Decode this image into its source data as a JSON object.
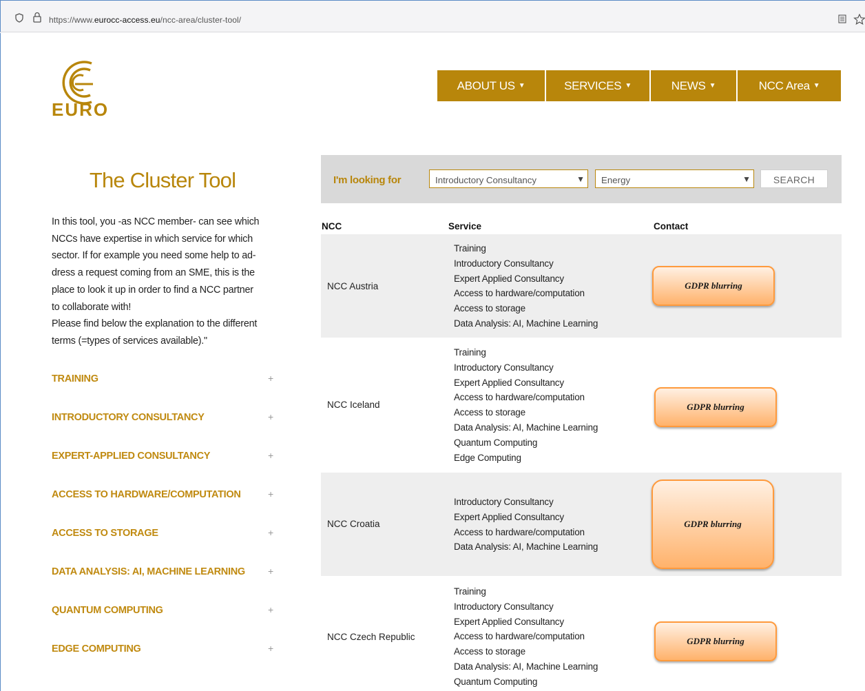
{
  "browser": {
    "url_prefix": "https://www.",
    "url_domain": "eurocc-access.eu",
    "url_path": "/ncc-area/cluster-tool/"
  },
  "logo": {
    "text": "EURO"
  },
  "nav": [
    {
      "label": "ABOUT US"
    },
    {
      "label": "SERVICES"
    },
    {
      "label": "NEWS"
    },
    {
      "label": "NCC Area"
    }
  ],
  "page_title": "The Cluster Tool",
  "intro": [
    "In this tool, you -as NCC member- can see which",
    "NCCs have expertise in which service for which",
    "sector. If for example you need some help to ad-",
    "dress a request coming from an SME, this is the",
    "place to look it up in order to find a NCC partner",
    "to collaborate with!",
    "Please find below the explanation to the different",
    "terms  (=types of services available).\""
  ],
  "accordion": [
    {
      "label": "TRAINING"
    },
    {
      "label": "INTRODUCTORY CONSULTANCY"
    },
    {
      "label": "EXPERT-APPLIED CONSULTANCY"
    },
    {
      "label": "ACCESS TO HARDWARE/COMPUTATION"
    },
    {
      "label": "ACCESS TO STORAGE"
    },
    {
      "label": "DATA ANALYSIS: AI, MACHINE LEARNING"
    },
    {
      "label": "QUANTUM COMPUTING"
    },
    {
      "label": "EDGE COMPUTING"
    }
  ],
  "accordion_toggle": "+",
  "search": {
    "label": "I'm looking for",
    "service_selected": "Introductory Consultancy",
    "sector_selected": "Energy",
    "button": "SEARCH"
  },
  "table": {
    "headers": {
      "ncc": "NCC",
      "service": "Service",
      "contact": "Contact"
    },
    "rows": [
      {
        "ncc": "NCC Austria",
        "services": [
          "Training",
          "Introductory Consultancy",
          "Expert Applied Consultancy",
          "Access to hardware/computation",
          "Access to storage",
          "Data Analysis: AI, Machine Learning"
        ],
        "contact": "GDPR blurring"
      },
      {
        "ncc": "NCC Iceland",
        "services": [
          "Training",
          "Introductory Consultancy",
          "Expert Applied Consultancy",
          "Access to hardware/computation",
          "Access to storage",
          "Data Analysis: AI, Machine Learning",
          "Quantum Computing",
          "Edge Computing"
        ],
        "contact": "GDPR blurring"
      },
      {
        "ncc": "NCC Croatia",
        "services": [
          "Introductory Consultancy",
          "Expert Applied Consultancy",
          "Access to hardware/computation",
          "Data Analysis: AI, Machine Learning"
        ],
        "contact": "GDPR blurring"
      },
      {
        "ncc": "NCC Czech Republic",
        "services": [
          "Training",
          "Introductory Consultancy",
          "Expert Applied Consultancy",
          "Access to hardware/computation",
          "Access to storage",
          "Data Analysis: AI, Machine Learning",
          "Quantum Computing"
        ],
        "contact": "GDPR blurring"
      }
    ]
  },
  "colors": {
    "brand_gold": "#b8860b",
    "row_grey": "#eeeeee",
    "search_grey": "#d9d9d9"
  }
}
